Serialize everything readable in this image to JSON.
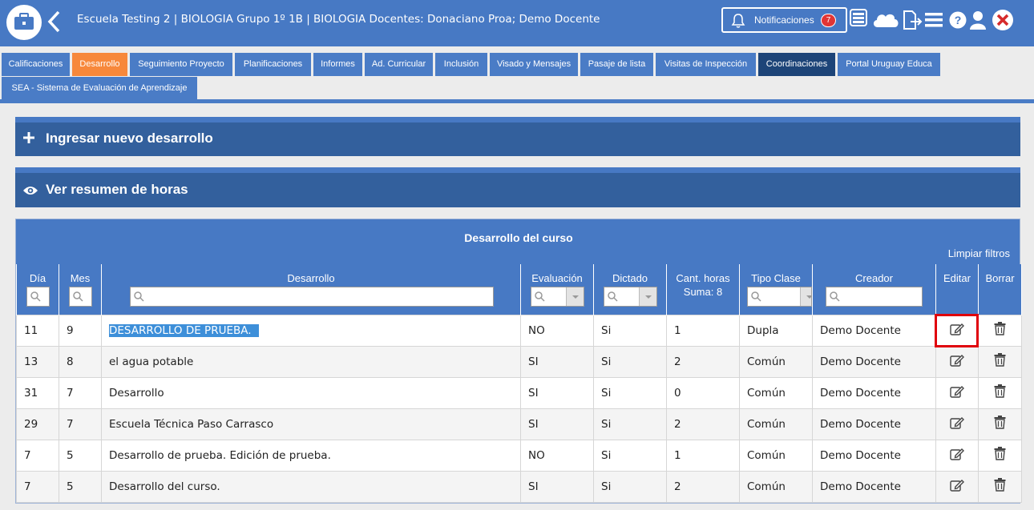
{
  "header": {
    "title": "Escuela Testing 2 | BIOLOGIA Grupo 1º 1B | BIOLOGIA Docentes: Donaciano Proa; Demo Docente",
    "notifications_label": "Notificaciones",
    "notifications_count": "7",
    "icons": [
      "briefcase-icon",
      "back-arrow-icon",
      "bell-icon",
      "list-card-icon",
      "cloud-icon",
      "export-file-icon",
      "hamburger-menu-icon",
      "help-icon",
      "user-icon",
      "close-icon"
    ]
  },
  "tabs": [
    {
      "label": "Calificaciones"
    },
    {
      "label": "Desarrollo",
      "active": true
    },
    {
      "label": "Seguimiento Proyecto"
    },
    {
      "label": "Planificaciones"
    },
    {
      "label": "Informes"
    },
    {
      "label": "Ad. Curricular"
    },
    {
      "label": "Inclusión"
    },
    {
      "label": "Visado y Mensajes"
    },
    {
      "label": "Pasaje de lista"
    },
    {
      "label": "Visitas de Inspección"
    },
    {
      "label": "Coordinaciones"
    },
    {
      "label": "Portal Uruguay Educa"
    },
    {
      "label": "SEA - Sistema de Evaluación de Aprendizaje"
    }
  ],
  "panels": {
    "new_label": "Ingresar nuevo desarrollo",
    "summary_label": "Ver resumen de horas"
  },
  "table": {
    "caption": "Desarrollo del curso",
    "clear_filters": "Limpiar filtros",
    "headers": {
      "dia": "Día",
      "mes": "Mes",
      "desarrollo": "Desarrollo",
      "evaluacion": "Evaluación",
      "dictado": "Dictado",
      "horas": "Cant. horas",
      "horas_sum": "Suma: 8",
      "tipo": "Tipo Clase",
      "creador": "Creador",
      "editar": "Editar",
      "borrar": "Borrar"
    },
    "rows": [
      {
        "dia": "11",
        "mes": "9",
        "desarrollo": "DESARROLLO DE PRUEBA.",
        "evaluacion": "NO",
        "dictado": "Si",
        "horas": "1",
        "tipo": "Dupla",
        "creador": "Demo Docente"
      },
      {
        "dia": "13",
        "mes": "8",
        "desarrollo": "el agua potable",
        "evaluacion": "SI",
        "dictado": "Si",
        "horas": "2",
        "tipo": "Común",
        "creador": "Demo Docente"
      },
      {
        "dia": "31",
        "mes": "7",
        "desarrollo": "Desarrollo",
        "evaluacion": "SI",
        "dictado": "Si",
        "horas": "0",
        "tipo": "Común",
        "creador": "Demo Docente"
      },
      {
        "dia": "29",
        "mes": "7",
        "desarrollo": "Escuela Técnica Paso Carrasco",
        "evaluacion": "SI",
        "dictado": "Si",
        "horas": "2",
        "tipo": "Común",
        "creador": "Demo Docente"
      },
      {
        "dia": "7",
        "mes": "5",
        "desarrollo": "Desarrollo de prueba. Edición de prueba.",
        "evaluacion": "NO",
        "dictado": "Si",
        "horas": "1",
        "tipo": "Común",
        "creador": "Demo Docente"
      },
      {
        "dia": "7",
        "mes": "5",
        "desarrollo": "Desarrollo del curso.",
        "evaluacion": "SI",
        "dictado": "Si",
        "horas": "2",
        "tipo": "Común",
        "creador": "Demo Docente"
      }
    ]
  },
  "colors": {
    "header_blue": "#4779c4",
    "panel_blue": "#33609d",
    "active_tab": "#f7883b",
    "dark_tab": "#1d4478",
    "highlight": "#3d8fd9",
    "annotation_red": "#e0000b"
  }
}
